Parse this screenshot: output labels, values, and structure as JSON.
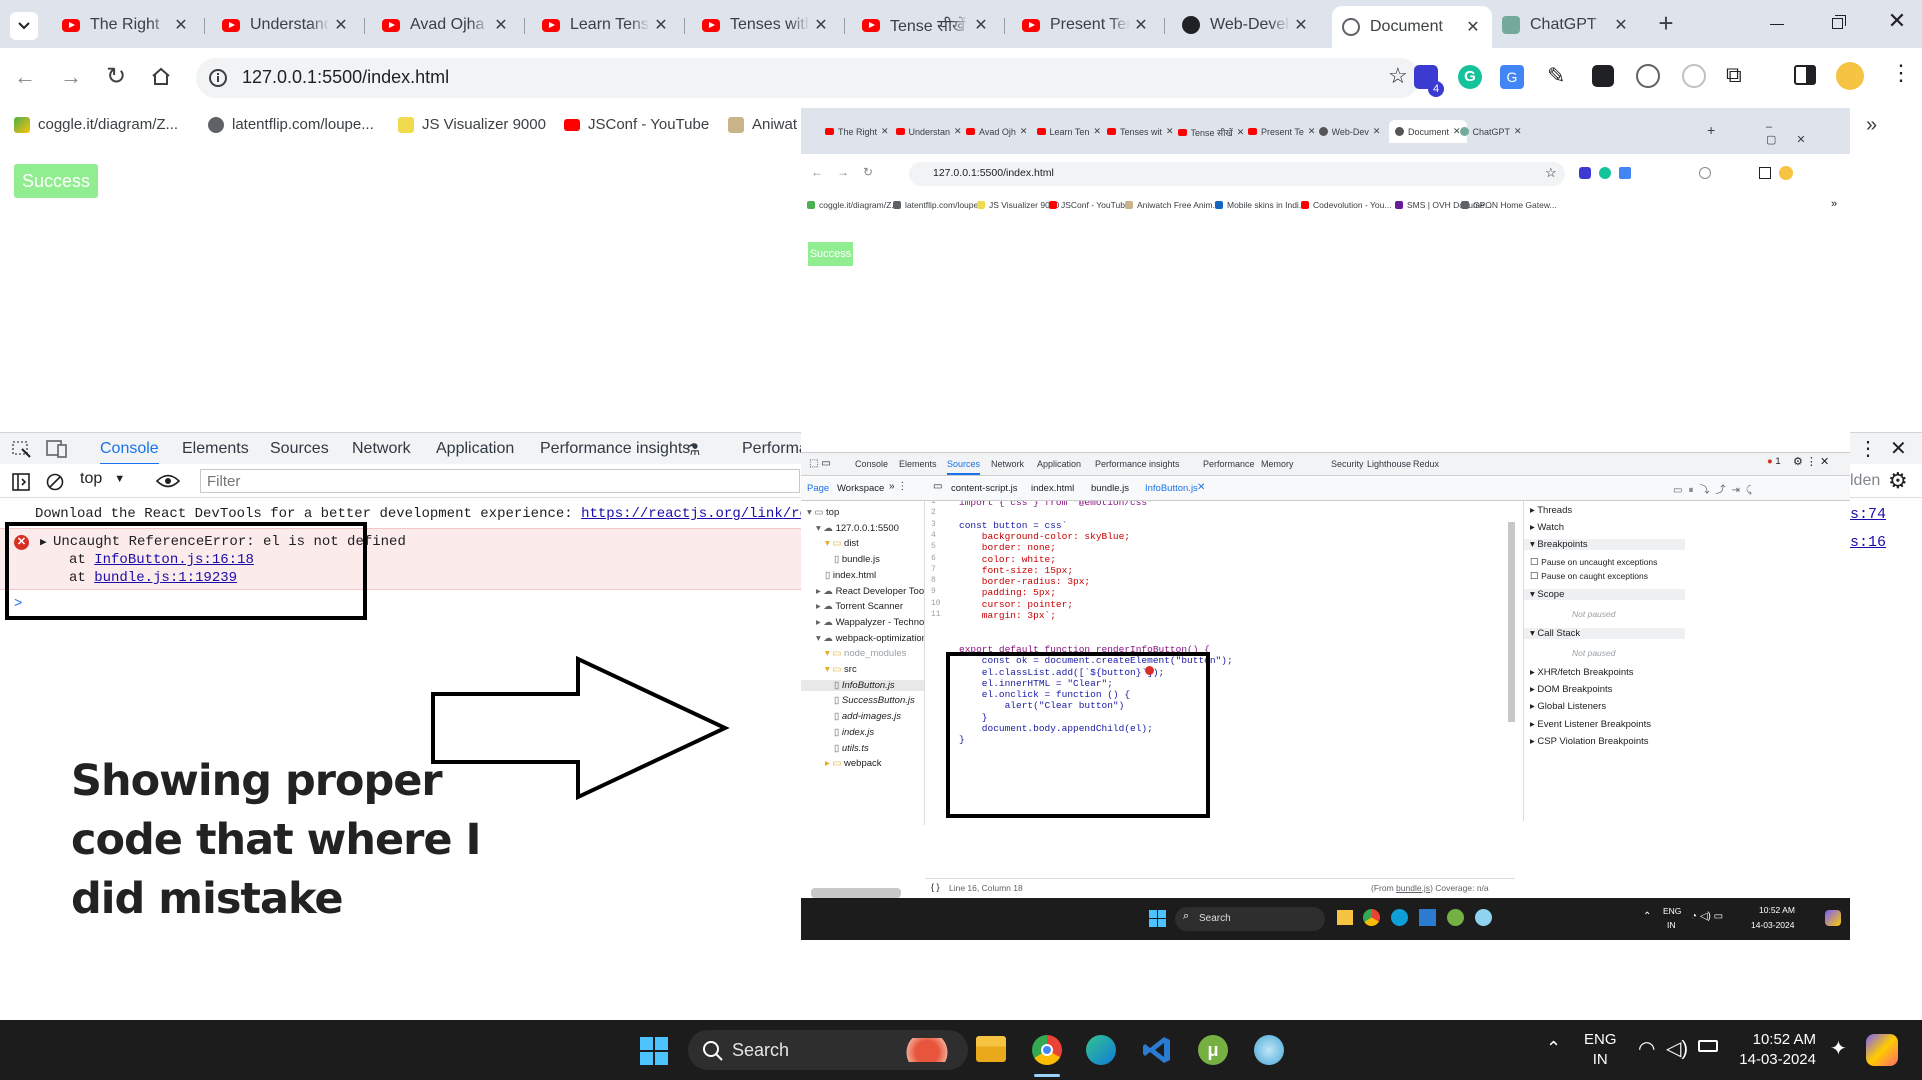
{
  "browser": {
    "tabs": [
      {
        "title": "The Right ",
        "type": "youtube"
      },
      {
        "title": "Understanding",
        "type": "youtube"
      },
      {
        "title": "Avad Ojha",
        "type": "youtube"
      },
      {
        "title": "Learn Tenses",
        "type": "youtube"
      },
      {
        "title": "Tenses with",
        "type": "youtube"
      },
      {
        "title": "Tense सीखें",
        "type": "youtube"
      },
      {
        "title": "Present Tense",
        "type": "youtube"
      },
      {
        "title": "Web-Development",
        "type": "github"
      },
      {
        "title": "Document",
        "type": "globe",
        "active": true
      },
      {
        "title": "ChatGPT",
        "type": "chatgpt"
      }
    ],
    "url": "127.0.0.1:5500/index.html",
    "bookmarks": [
      {
        "label": "coggle.it/diagram/Z...",
        "icon": "coggle"
      },
      {
        "label": "latentflip.com/loupe...",
        "icon": "globe"
      },
      {
        "label": "JS Visualizer 9000",
        "icon": "js"
      },
      {
        "label": "JSConf - YouTube",
        "icon": "youtube"
      },
      {
        "label": "Aniwat",
        "icon": "aniwatch"
      }
    ],
    "overflow_chevron": "»",
    "profile_badge": "4"
  },
  "page": {
    "success_button": "Success"
  },
  "devtools": {
    "tabs": [
      "Console",
      "Elements",
      "Sources",
      "Network",
      "Application",
      "Performance insights",
      "Performa"
    ],
    "active_tab": "Console",
    "context": "top",
    "filter_placeholder": "Filter",
    "messages": {
      "react_hint": "Download the React DevTools for a better development experience: ",
      "react_link": "https://reactjs.org/link/rea",
      "error_text": "Uncaught ReferenceError: el is not defined",
      "at": "at",
      "stack1": "InfoButton.js:16:18",
      "stack2": "bundle.js:1:19239",
      "prompt": ">"
    },
    "right_frags": [
      "lden",
      "s:74",
      "s:16"
    ]
  },
  "annotation": {
    "caption_line1": "Showing proper",
    "caption_line2": "code that where I",
    "caption_line3": "did mistake"
  },
  "embedded": {
    "tabs": [
      "The Right",
      "Understan",
      "Avad Ojh",
      "Learn Ten",
      "Tenses wit",
      "Tense सीखें",
      "Present Te",
      "Web-Dev",
      "Document",
      "ChatGPT"
    ],
    "url": "127.0.0.1:5500/index.html",
    "bookmarks": [
      "coggle.it/diagram/Z...",
      "latentflip.com/loupe...",
      "JS Visualizer 9000",
      "JSConf - YouTube",
      "Aniwatch Free Anim...",
      "Mobile skins in Indi...",
      "Codevolution - You...",
      "SMS | OVH Docume...",
      "GPON Home Gatew..."
    ],
    "success": "Success",
    "dt_tabs": [
      "Console",
      "Elements",
      "Sources",
      "Network",
      "Application",
      "Performance insights",
      "Performance",
      "Memory",
      "Security",
      "Lighthouse",
      "Redux"
    ],
    "error_count": "1",
    "nav_tabs": [
      "Page",
      "Workspace"
    ],
    "file_tabs": [
      "content-script.js",
      "index.html",
      "bundle.js",
      "InfoButton.js"
    ],
    "tree": [
      {
        "label": "top",
        "indent": 0,
        "kind": "frame"
      },
      {
        "label": "127.0.0.1:5500",
        "indent": 1,
        "kind": "cloud"
      },
      {
        "label": "dist",
        "indent": 2,
        "kind": "folder"
      },
      {
        "label": "bundle.js",
        "indent": 3,
        "kind": "file"
      },
      {
        "label": "index.html",
        "indent": 2,
        "kind": "file"
      },
      {
        "label": "React Developer Tools",
        "indent": 1,
        "kind": "cloud"
      },
      {
        "label": "Torrent Scanner",
        "indent": 1,
        "kind": "cloud"
      },
      {
        "label": "Wappalyzer - Technology",
        "indent": 1,
        "kind": "cloud"
      },
      {
        "label": "webpack-optimization-st",
        "indent": 1,
        "kind": "cloud"
      },
      {
        "label": "node_modules",
        "indent": 2,
        "kind": "folder-dim"
      },
      {
        "label": "src",
        "indent": 2,
        "kind": "folder"
      },
      {
        "label": "InfoButton.js",
        "indent": 3,
        "kind": "file-italic"
      },
      {
        "label": "SuccessButton.js",
        "indent": 3,
        "kind": "file-italic"
      },
      {
        "label": "add-images.js",
        "indent": 3,
        "kind": "file-italic"
      },
      {
        "label": "index.js",
        "indent": 3,
        "kind": "file-italic"
      },
      {
        "label": "utils.ts",
        "indent": 3,
        "kind": "file-italic"
      },
      {
        "label": "webpack",
        "indent": 2,
        "kind": "folder"
      }
    ],
    "code_lines": [
      "import { css } from '@emotion/css'",
      "",
      "const button = css`",
      "    background-color: skyBlue;",
      "    border: none;",
      "    color: white;",
      "    font-size: 15px;",
      "    border-radius: 3px;",
      "    padding: 5px;",
      "    cursor: pointer;",
      "    margin: 3px`;",
      "",
      "",
      "export default function renderInfoButton() {",
      "    const ok = document.createElement(\"button\");",
      "    el.classList.add([`${button}`]);",
      "    el.innerHTML = \"Clear\";",
      "    el.onclick = function () {",
      "        alert(\"Clear button\")",
      "    }",
      "    document.body.appendChild(el);",
      "}"
    ],
    "right_panel": [
      "Threads",
      "Watch",
      "Breakpoints",
      "Pause on uncaught exceptions",
      "Pause on caught exceptions",
      "Scope",
      "Not paused",
      "Call Stack",
      "Not paused",
      "XHR/fetch Breakpoints",
      "DOM Breakpoints",
      "Global Listeners",
      "Event Listener Breakpoints",
      "CSP Violation Breakpoints"
    ],
    "status_left": "Line 16, Column 18",
    "status_right_prefix": "(From ",
    "status_right_link": "bundle.js",
    "status_right_suffix": ") Coverage: n/a",
    "taskbar": {
      "search": "Search",
      "lang1": "ENG",
      "lang2": "IN",
      "time": "10:52 AM",
      "date": "14-03-2024"
    }
  },
  "taskbar": {
    "search": "Search",
    "lang1": "ENG",
    "lang2": "IN",
    "time": "10:52 AM",
    "date": "14-03-2024"
  }
}
